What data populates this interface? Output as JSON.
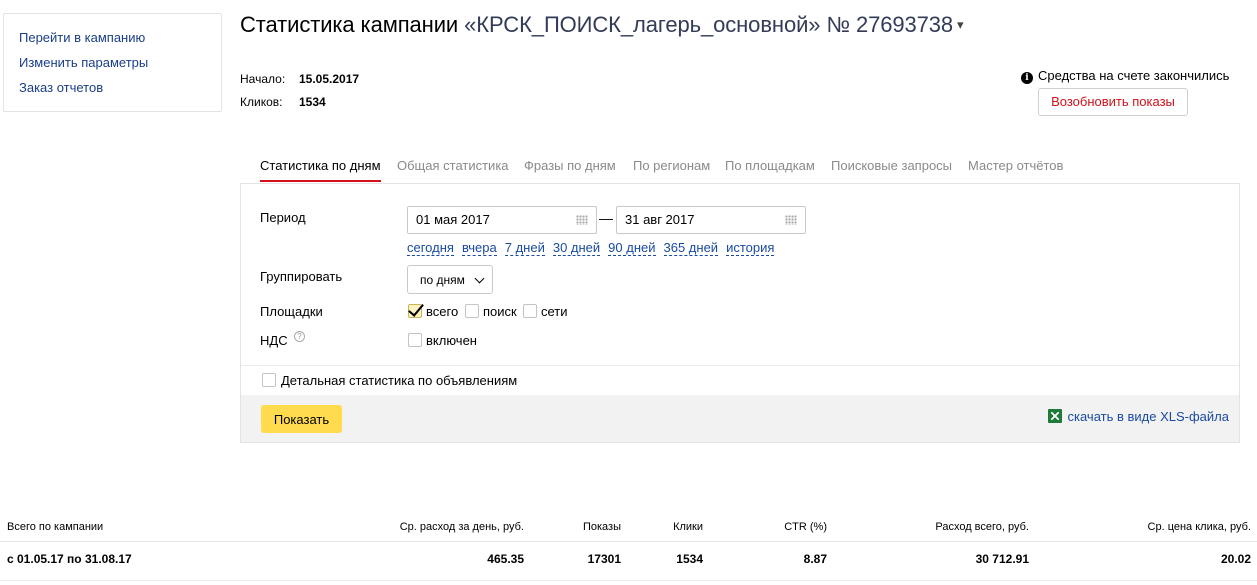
{
  "sidebar": {
    "links": [
      "Перейти в кампанию",
      "Изменить параметры",
      "Заказ отчетов"
    ]
  },
  "header": {
    "title_prefix": "Статистика кампании",
    "campaign_name": "«КРСК_ПОИСК_лагерь_основной»",
    "campaign_number": "№ 27693738",
    "caret": "▾"
  },
  "meta": {
    "start_label": "Начало:",
    "start_value": "15.05.2017",
    "clicks_label": "Кликов:",
    "clicks_value": "1534"
  },
  "notice": {
    "icon": "i",
    "text": "Средства на счете закончились",
    "button": "Возобновить показы"
  },
  "tabs": [
    "Статистика по дням",
    "Общая статистика",
    "Фразы по дням",
    "По регионам",
    "По площадкам",
    "Поисковые запросы",
    "Мастер отчётов"
  ],
  "form": {
    "period_label": "Период",
    "date_from": "01 мая 2017",
    "date_to": "31 авг 2017",
    "dash": "—",
    "quick_ranges": [
      "сегодня",
      "вчера",
      "7 дней",
      "30 дней",
      "90 дней",
      "365 дней",
      "история"
    ],
    "group_label": "Группировать",
    "group_value": "по дням",
    "places_label": "Площадки",
    "places": [
      {
        "label": "всего",
        "checked": true
      },
      {
        "label": "поиск",
        "checked": false
      },
      {
        "label": "сети",
        "checked": false
      }
    ],
    "vat_label": "НДС",
    "vat_help": "?",
    "vat_option": "включен",
    "detailed_label": "Детальная статистика по объявлениям",
    "show_button": "Показать",
    "xls_link": "скачать в виде XLS-файла"
  },
  "summary": {
    "headers": [
      "Всего по кампании",
      "Ср. расход за день, руб.",
      "Показы",
      "Клики",
      "CTR (%)",
      "Расход всего, руб.",
      "Ср. цена клика, руб."
    ],
    "row": [
      "с 01.05.17 по 31.08.17",
      "465.35",
      "17301",
      "1534",
      "8.87",
      "30 712.91",
      "20.02"
    ]
  }
}
